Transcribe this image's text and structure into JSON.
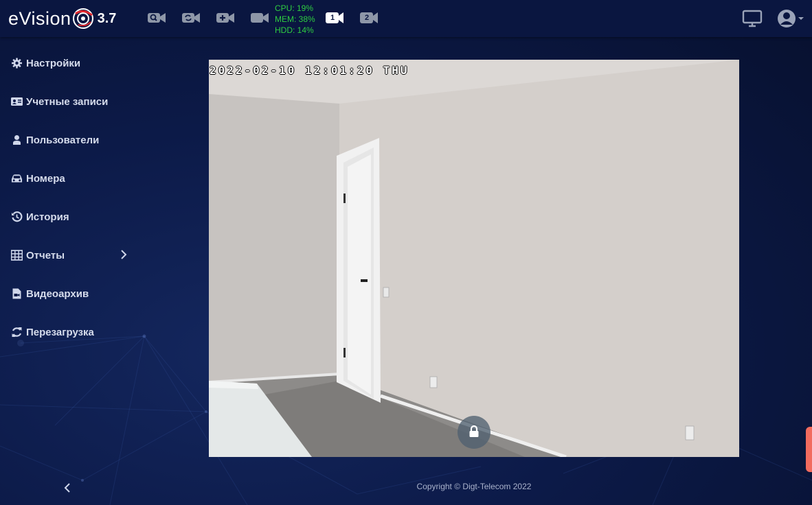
{
  "app": {
    "brand": "eVision",
    "version": "3.7"
  },
  "toolbar": {
    "icons": [
      "camera-search-icon",
      "camera-sync-icon",
      "camera-add-icon",
      "video-camera-icon"
    ],
    "layouts": [
      {
        "label": "1",
        "active": true
      },
      {
        "label": "2",
        "active": false
      }
    ]
  },
  "stats": {
    "cpu": "CPU: 19%",
    "mem": "MEM: 38%",
    "hdd": "HDD: 14%",
    "color": "#2ecc40"
  },
  "sidebar": {
    "items": [
      {
        "label": "Настройки",
        "icon": "gear-icon"
      },
      {
        "label": "Учетные записи",
        "icon": "id-card-icon"
      },
      {
        "label": "Пользователи",
        "icon": "user-icon"
      },
      {
        "label": "Номера",
        "icon": "car-icon"
      },
      {
        "label": "История",
        "icon": "history-icon"
      },
      {
        "label": "Отчеты",
        "icon": "table-icon"
      },
      {
        "label": "Видеоархив",
        "icon": "file-video-icon"
      },
      {
        "label": "Перезагрузка",
        "icon": "refresh-icon"
      }
    ]
  },
  "video": {
    "timestamp": "2022-02-10 12:01:20 THU"
  },
  "footer": {
    "copyright": "Copyright © Digt-Telecom 2022"
  },
  "colors": {
    "background": "#0c1a48",
    "topbar": "#0a1640",
    "side_tab": "#f26b5e"
  }
}
